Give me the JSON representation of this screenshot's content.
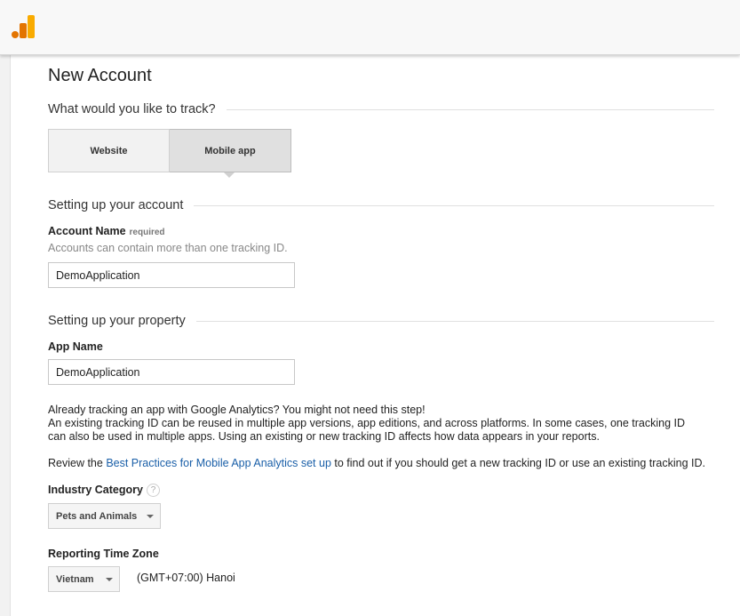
{
  "page": {
    "title": "New Account"
  },
  "track": {
    "heading": "What would you like to track?",
    "options": [
      "Website",
      "Mobile app"
    ],
    "selected": "Mobile app"
  },
  "account": {
    "heading": "Setting up your account",
    "name_label": "Account Name",
    "required_label": "required",
    "hint": "Accounts can contain more than one tracking ID.",
    "name_value": "DemoApplication"
  },
  "property": {
    "heading": "Setting up your property",
    "app_name_label": "App Name",
    "app_name_value": "DemoApplication"
  },
  "info": {
    "line1": "Already tracking an app with Google Analytics? You might not need this step!",
    "line2": "An existing tracking ID can be reused in multiple app versions, app editions, and across platforms. In some cases, one tracking ID can also be used in multiple apps. Using an existing or new tracking ID affects how data appears in your reports.",
    "review_prefix": "Review the ",
    "review_link": "Best Practices for Mobile App Analytics set up",
    "review_suffix": " to find out if you should get a new tracking ID or use an existing tracking ID."
  },
  "industry": {
    "label": "Industry Category",
    "help_icon": "?",
    "selected": "Pets and Animals"
  },
  "timezone": {
    "label": "Reporting Time Zone",
    "country": "Vietnam",
    "zone": "(GMT+07:00) Hanoi"
  },
  "colors": {
    "logo_dark": "#e37400",
    "logo_light": "#f9ab00",
    "link": "#1a5fa8"
  }
}
